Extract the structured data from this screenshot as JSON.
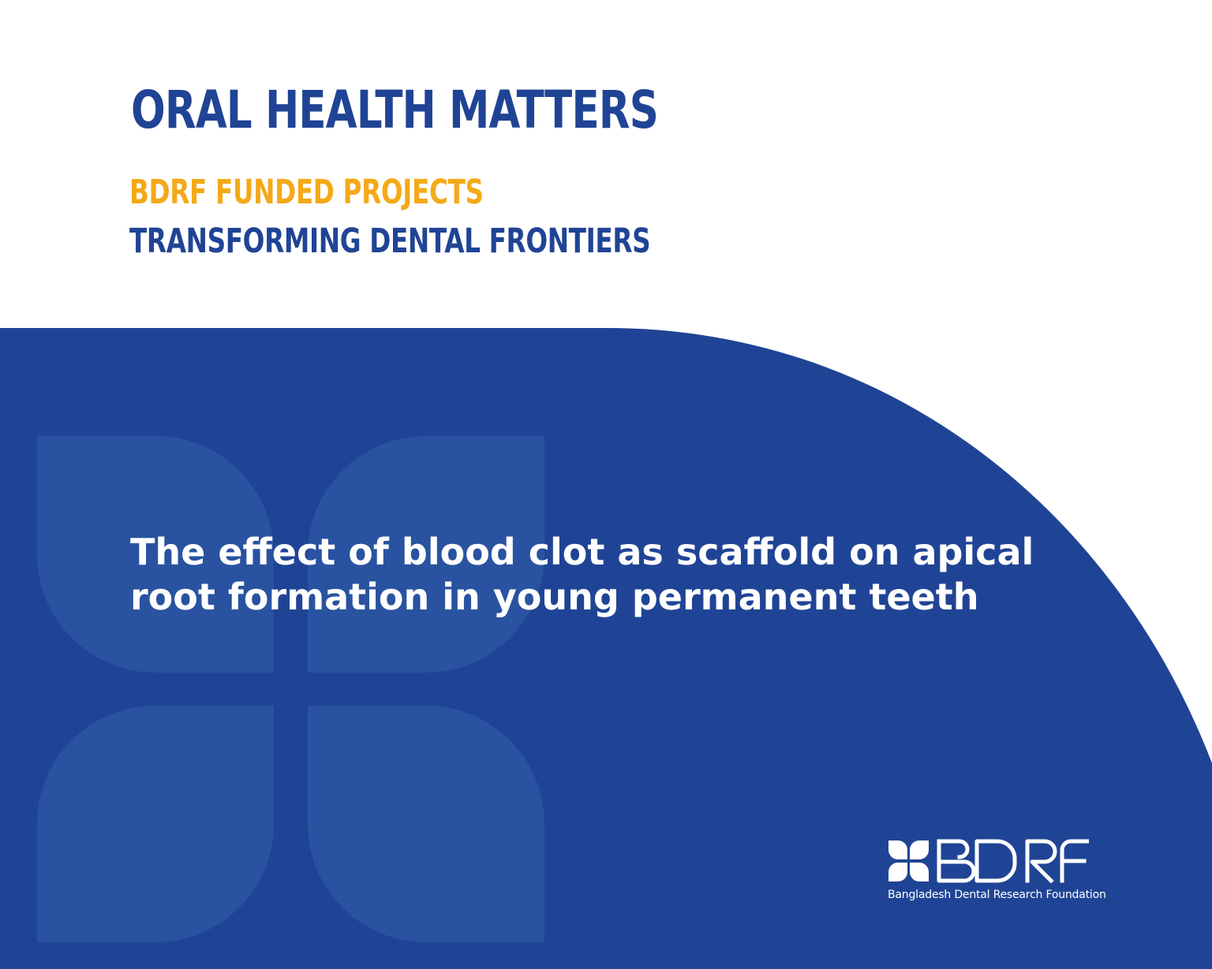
{
  "header": {
    "headline": "ORAL HEALTH MATTERS",
    "subhead_primary": "BDRF FUNDED PROJECTS",
    "subhead_secondary": "TRANSFORMING DENTAL FRONTIERS"
  },
  "main": {
    "project_title": "The effect of blood clot as scaffold on apical root formation in young permanent teeth"
  },
  "brand": {
    "logo_text": "BDRF",
    "tagline": "Bangladesh Dental Research Foundation",
    "icon": "petal-cross-icon"
  },
  "colors": {
    "navy": "#204495",
    "amber": "#F5A918",
    "watermark": "#2C55A3",
    "white": "#FFFFFF"
  }
}
